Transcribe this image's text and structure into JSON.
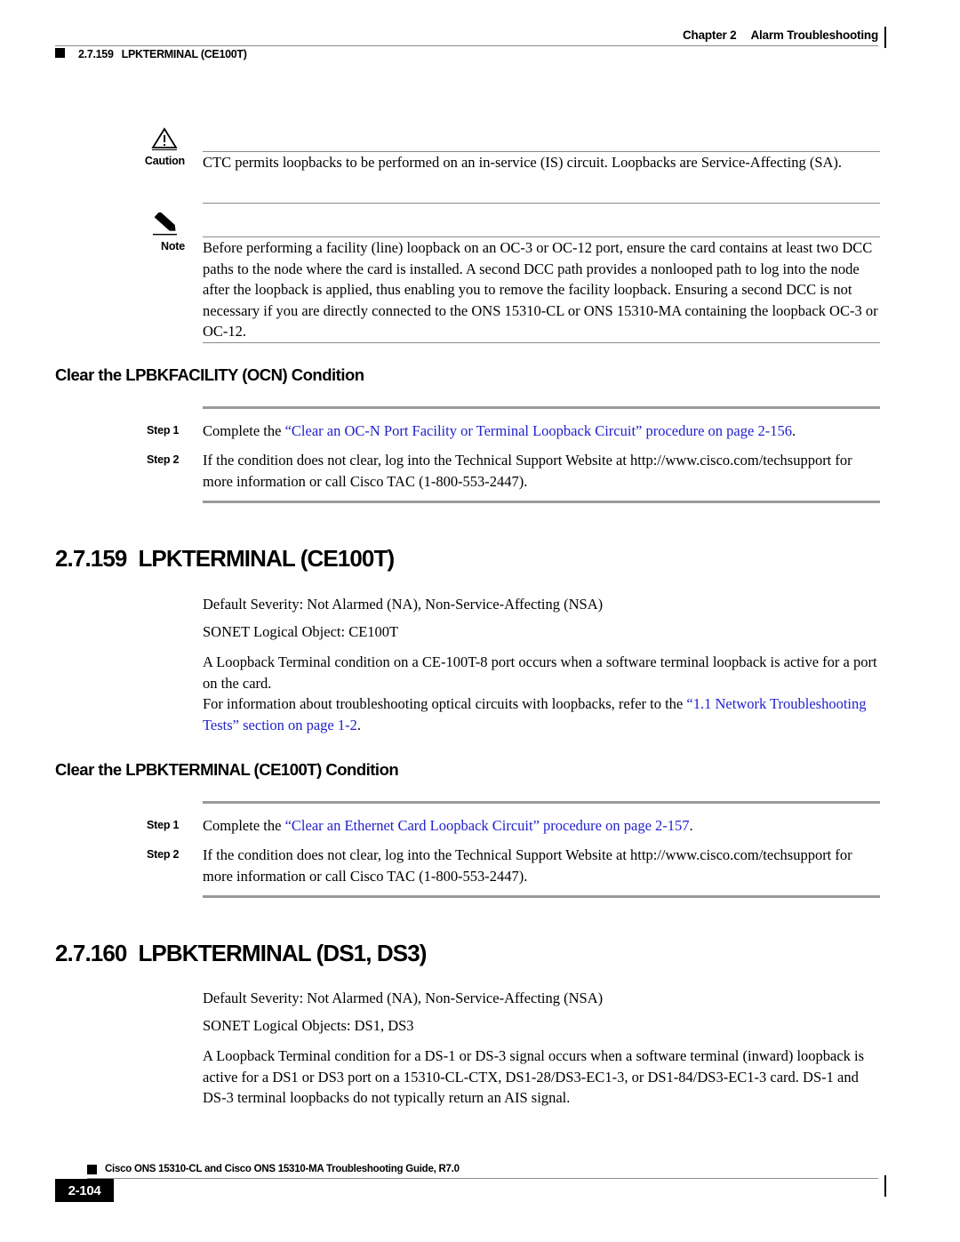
{
  "header": {
    "chapter_number": "Chapter 2",
    "chapter_title": "Alarm Troubleshooting",
    "section_number": "2.7.159",
    "section_title": "LPKTERMINAL (CE100T)"
  },
  "caution": {
    "label": "Caution",
    "icon": "warning-triangle-icon",
    "text": "CTC permits loopbacks to be performed on an in-service (IS) circuit. Loopbacks are Service-Affecting (SA)."
  },
  "note": {
    "label": "Note",
    "icon": "pencil-icon",
    "text": "Before performing a facility (line) loopback on an OC-3 or OC-12 port, ensure the card contains at least two DCC paths to the node where the card is installed. A second DCC path provides a nonlooped path to log into the node after the loopback is applied, thus enabling you to remove the facility loopback. Ensuring a second DCC is not necessary if you are directly connected to the ONS 15310-CL or ONS 15310-MA containing the loopback OC-3 or OC-12."
  },
  "section_ocn_clear": {
    "heading": "Clear the LPBKFACILITY (OCN) Condition",
    "steps": [
      {
        "label": "Step 1",
        "prefix": "Complete the ",
        "link": "“Clear an OC-N Port Facility or Terminal Loopback Circuit” procedure on page 2-156",
        "suffix": "."
      },
      {
        "label": "Step 2",
        "prefix": "If the condition does not clear, log into the Technical Support Website at http://www.cisco.com/techsupport for more information or call Cisco TAC (1-800-553-2447).",
        "link": "",
        "suffix": ""
      }
    ]
  },
  "section_lpkterminal_ce100t": {
    "number": "2.7.159",
    "title": "LPKTERMINAL (CE100T)",
    "severity": "Default Severity: Not Alarmed (NA), Non-Service-Affecting (NSA)",
    "logical_object": "SONET Logical Object: CE100T",
    "description": "A Loopback Terminal condition on a CE-100T-8 port occurs when a software terminal loopback is active for a port on the card.",
    "reference_prefix": "For information about troubleshooting optical circuits with loopbacks, refer to the ",
    "reference_link": "“1.1  Network Troubleshooting Tests” section on page 1-2",
    "reference_suffix": "."
  },
  "section_ce100t_clear": {
    "heading": "Clear the LPBKTERMINAL (CE100T) Condition",
    "steps": [
      {
        "label": "Step 1",
        "prefix": "Complete the ",
        "link": "“Clear an Ethernet Card Loopback Circuit” procedure on page 2-157",
        "suffix": "."
      },
      {
        "label": "Step 2",
        "prefix": "If the condition does not clear, log into the Technical Support Website at http://www.cisco.com/techsupport for more information or call Cisco TAC (1-800-553-2447).",
        "link": "",
        "suffix": ""
      }
    ]
  },
  "section_lpbkterminal_ds": {
    "number": "2.7.160",
    "title": "LPBKTERMINAL (DS1, DS3)",
    "severity": "Default Severity: Not Alarmed (NA), Non-Service-Affecting (NSA)",
    "logical_object": "SONET Logical Objects: DS1, DS3",
    "description": "A Loopback Terminal condition for a DS-1 or DS-3 signal occurs when a software terminal (inward) loopback is active for a DS1 or DS3 port on a 15310-CL-CTX, DS1-28/DS3-EC1-3, or DS1-84/DS3-EC1-3 card. DS-1 and DS-3 terminal loopbacks do not typically return an AIS signal."
  },
  "footer": {
    "guide_title": "Cisco ONS 15310-CL and Cisco ONS 15310-MA Troubleshooting Guide, R7.0",
    "page_number": "2-104"
  },
  "colors": {
    "link": "#2222cc",
    "rule": "#8a8a8a",
    "step_rule": "#9a9a9a",
    "text": "#000000"
  }
}
